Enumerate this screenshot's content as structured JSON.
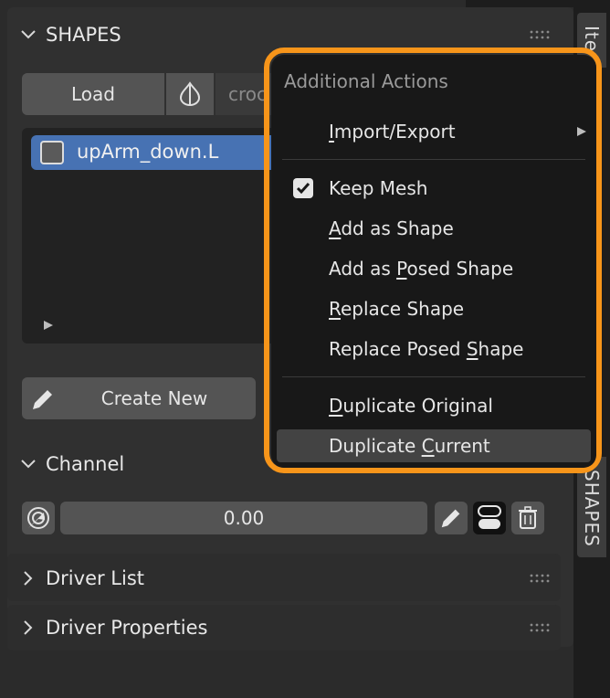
{
  "shapes_panel": {
    "header": "SHAPES",
    "load_button": "Load",
    "object_field_value": "croc",
    "list_items": [
      "upArm_down.L"
    ],
    "create_new_button": "Create New"
  },
  "channel_panel": {
    "header": "Channel",
    "value": "0.00"
  },
  "driver_list_panel": {
    "header": "Driver List"
  },
  "driver_properties_panel": {
    "header": "Driver Properties"
  },
  "side_tabs": {
    "item_tab": "Ite",
    "shapes_tab": "SHAPES"
  },
  "menu": {
    "title": "Additional Actions",
    "items": [
      {
        "pre": "",
        "u": "I",
        "post": "mport/Export",
        "submenu": true
      },
      {
        "pre": "Keep Mesh",
        "u": "",
        "post": "",
        "checked": true
      },
      {
        "pre": "",
        "u": "A",
        "post": "dd as Shape"
      },
      {
        "pre": "Add as ",
        "u": "P",
        "post": "osed Shape"
      },
      {
        "pre": "",
        "u": "R",
        "post": "eplace Shape"
      },
      {
        "pre": "Replace Posed ",
        "u": "S",
        "post": "hape"
      },
      {
        "pre": "",
        "u": "D",
        "post": "uplicate Original"
      },
      {
        "pre": "Duplicate ",
        "u": "C",
        "post": "urrent",
        "active": true
      }
    ]
  },
  "colors": {
    "accent_selection": "#4772b3",
    "highlight_outline": "#f7951a",
    "panel_bg": "#303030",
    "button_bg": "#545454"
  },
  "icons": [
    "chevron-down-icon",
    "chevron-right-icon",
    "grip-icon",
    "onion-skin-icon",
    "triangle-right-icon",
    "pencil-icon",
    "target-arrow-icon",
    "toggle-icon",
    "trash-icon",
    "check-icon",
    "submenu-arrow-icon"
  ]
}
